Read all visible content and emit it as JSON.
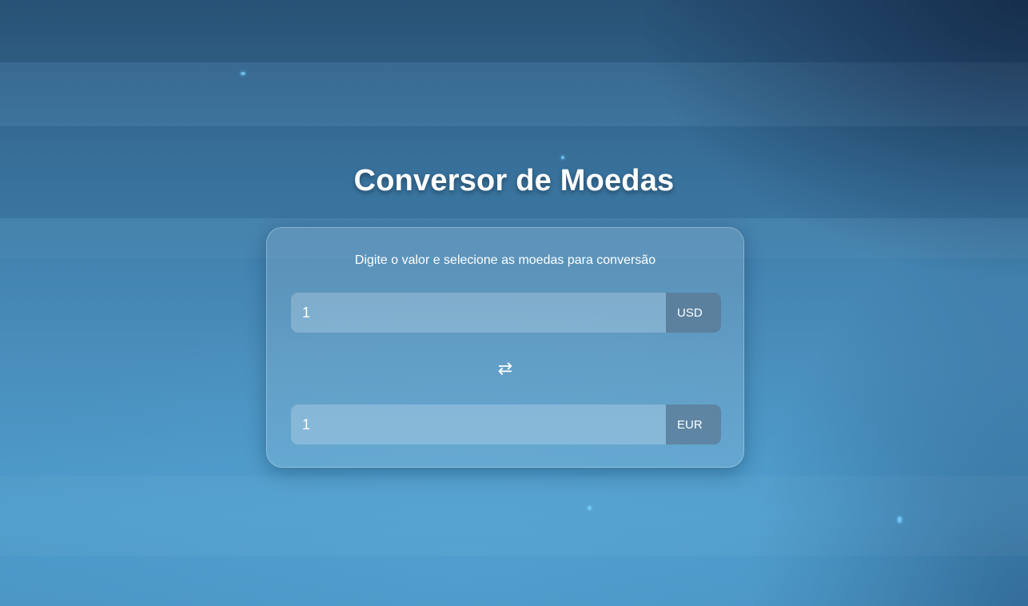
{
  "app": {
    "title": "Conversor de Moedas",
    "subtitle": "Digite o valor e selecione as moedas para conversão"
  },
  "converter": {
    "from": {
      "value": "1",
      "currency": "USD"
    },
    "swap_icon": "⇄",
    "to": {
      "value": "1",
      "currency": "EUR"
    }
  },
  "colors": {
    "background_top": "#2d5a80",
    "background_bottom": "#4a95c4",
    "text": "#ffffff"
  }
}
